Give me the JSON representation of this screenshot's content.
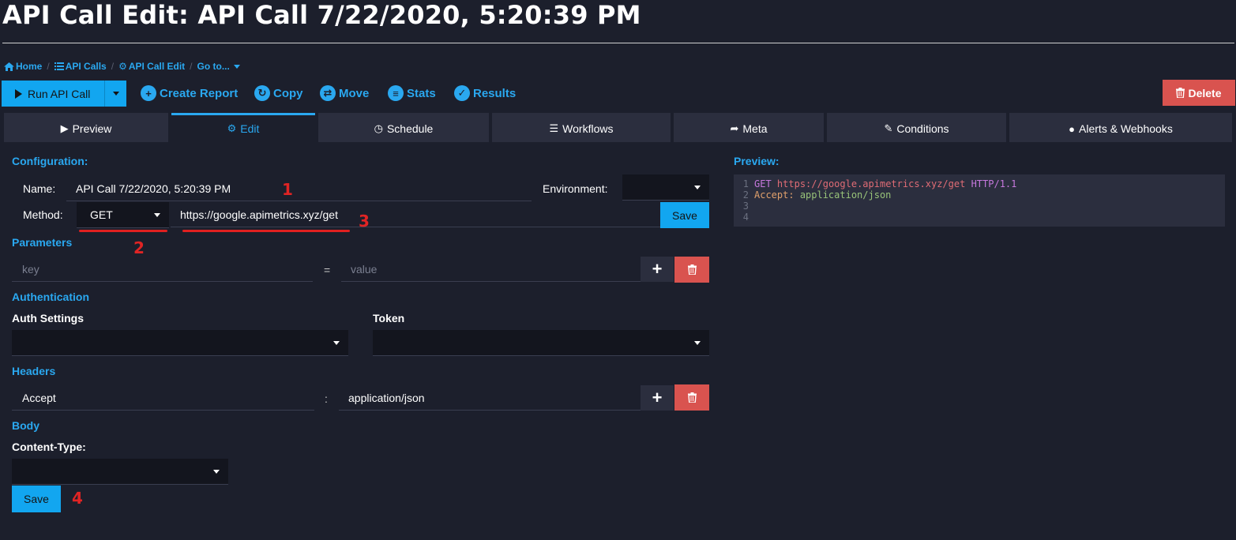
{
  "page": {
    "title": "API Call Edit: API Call 7/22/2020, 5:20:39 PM"
  },
  "breadcrumbs": [
    {
      "label": "Home",
      "icon": "home-icon"
    },
    {
      "label": "API Calls",
      "icon": "list-icon"
    },
    {
      "label": "API Call Edit",
      "icon": "gear-icon"
    },
    {
      "label": "Go to...",
      "icon": "chevron-down-icon"
    }
  ],
  "toolbar": {
    "run_label": "Run API Call",
    "create_report": "Create Report",
    "copy": "Copy",
    "move": "Move",
    "stats": "Stats",
    "results": "Results",
    "delete": "Delete"
  },
  "tabs": [
    {
      "label": "Preview",
      "icon": "play-icon"
    },
    {
      "label": "Edit",
      "icon": "gear-icon"
    },
    {
      "label": "Schedule",
      "icon": "clock-icon"
    },
    {
      "label": "Workflows",
      "icon": "list-icon"
    },
    {
      "label": "Meta",
      "icon": "share-icon"
    },
    {
      "label": "Conditions",
      "icon": "pencil-icon"
    },
    {
      "label": "Alerts & Webhooks",
      "icon": "globe-icon"
    }
  ],
  "config": {
    "section_label": "Configuration:",
    "name_label": "Name:",
    "name_value": "API Call 7/22/2020, 5:20:39 PM",
    "environment_label": "Environment:",
    "method_label": "Method:",
    "method_value": "GET",
    "url_value": "https://google.apimetrics.xyz/get",
    "save_label": "Save"
  },
  "parameters": {
    "section_label": "Parameters",
    "key_placeholder": "key",
    "equals": "=",
    "value_placeholder": "value"
  },
  "auth": {
    "section_label": "Authentication",
    "settings_label": "Auth Settings",
    "token_label": "Token"
  },
  "headers": {
    "section_label": "Headers",
    "key_value": "Accept",
    "colon": ":",
    "value_value": "application/json"
  },
  "body": {
    "section_label": "Body",
    "content_type_label": "Content-Type:",
    "save_label": "Save"
  },
  "preview": {
    "label": "Preview:",
    "lines": [
      {
        "num": "1",
        "method": "GET",
        "url": "https://google.apimetrics.xyz/get",
        "proto": "HTTP/1.1"
      },
      {
        "num": "2",
        "key": "Accept:",
        "value": "application/json"
      },
      {
        "num": "3"
      },
      {
        "num": "4"
      }
    ]
  },
  "annotations": [
    "1",
    "2",
    "3",
    "4"
  ],
  "colors": {
    "background": "#1c1f2c",
    "accent": "#2aa8f0",
    "danger": "#d9534f",
    "annotation": "#e02424"
  }
}
